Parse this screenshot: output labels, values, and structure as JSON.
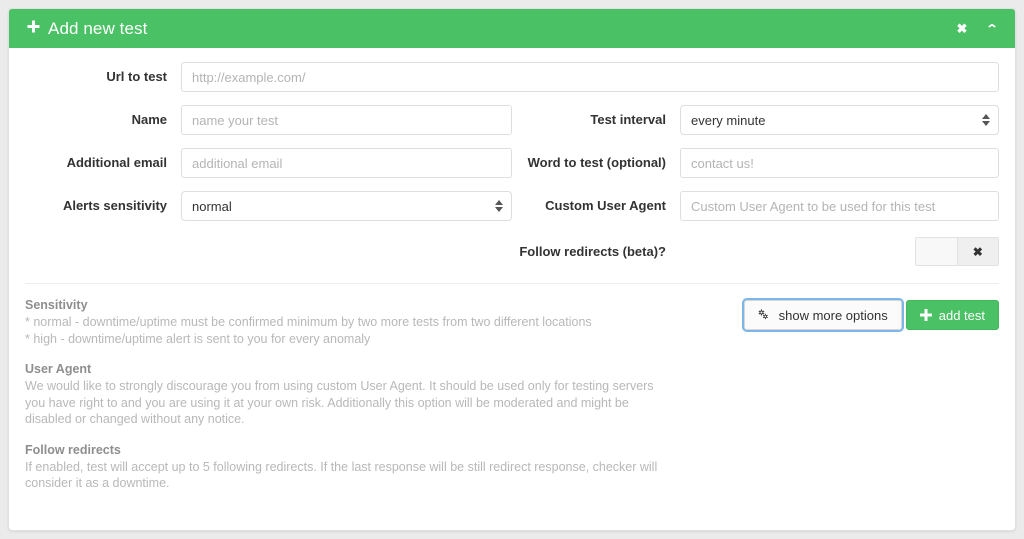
{
  "header": {
    "title": "Add new test",
    "plus_icon": "plus-icon",
    "close_icon": "✖",
    "collapse_icon": "⌃"
  },
  "form": {
    "url": {
      "label": "Url to test",
      "value": "",
      "placeholder": "http://example.com/"
    },
    "name": {
      "label": "Name",
      "value": "",
      "placeholder": "name your test"
    },
    "additional_email": {
      "label": "Additional email",
      "value": "",
      "placeholder": "additional email"
    },
    "alerts_sensitivity": {
      "label": "Alerts sensitivity",
      "value": "normal"
    },
    "test_interval": {
      "label": "Test interval",
      "value": "every minute"
    },
    "word_to_test": {
      "label": "Word to test (optional)",
      "value": "",
      "placeholder": "contact us!"
    },
    "custom_user_agent": {
      "label": "Custom User Agent",
      "value": "",
      "placeholder": "Custom User Agent to be used for this test"
    },
    "follow_redirects": {
      "label": "Follow redirects (beta)?",
      "state_icon": "✖"
    }
  },
  "help": {
    "sensitivity": {
      "title": "Sensitivity",
      "line1": "* normal - downtime/uptime must be confirmed minimum by two more tests from two different locations",
      "line2": "* high - downtime/uptime alert is sent to you for every anomaly"
    },
    "user_agent": {
      "title": "User Agent",
      "body": "We would like to strongly discourage you from using custom User Agent. It should be used only for testing servers you have right to and you are using it at your own risk. Additionally this option will be moderated and might be disabled or changed without any notice."
    },
    "follow_redirects": {
      "title": "Follow redirects",
      "body": "If enabled, test will accept up to 5 following redirects. If the last response will be still redirect response, checker will consider it as a downtime."
    }
  },
  "buttons": {
    "show_more_options": "show more options",
    "add_test": "add test"
  },
  "colors": {
    "brand_green": "#4ac164",
    "focus_blue": "#7cb7e8",
    "page_bg": "#ebebeb"
  }
}
